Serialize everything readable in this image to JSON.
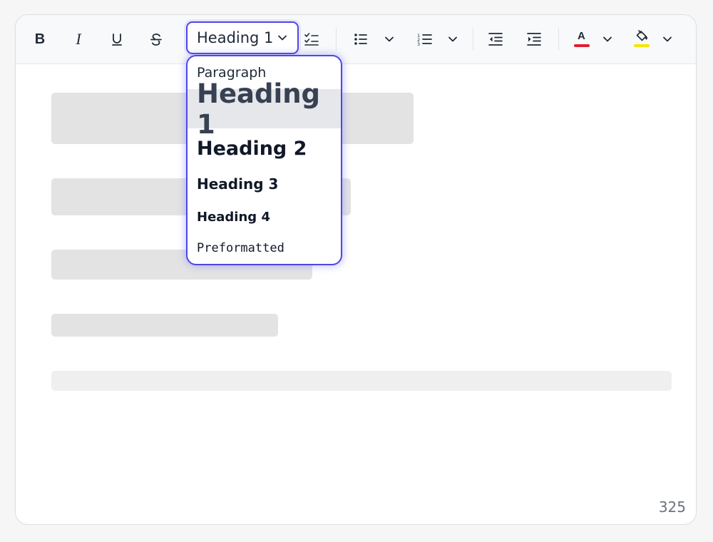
{
  "toolbar": {
    "buttons": {
      "bold": "bold-icon",
      "italic": "italic-icon",
      "underline": "underline-icon",
      "strikethrough": "strikethrough-icon",
      "checklist": "checklist-icon",
      "bullet_list": "bullet-list-icon",
      "numbered_list": "numbered-list-icon",
      "outdent": "outdent-icon",
      "indent": "indent-icon",
      "text_color": "text-color-icon",
      "highlight": "highlight-icon"
    },
    "bold_glyph": "B",
    "italic_glyph": "I",
    "text_color_glyph": "A",
    "block_select": {
      "value": "Heading 1"
    },
    "text_color": "#e11d2e",
    "highlight_color": "#f5e600"
  },
  "dropdown": {
    "items": [
      {
        "label": "Paragraph",
        "selected": false
      },
      {
        "label": "Heading 1",
        "selected": true
      },
      {
        "label": "Heading 2",
        "selected": false
      },
      {
        "label": "Heading 3",
        "selected": false
      },
      {
        "label": "Heading 4",
        "selected": false
      },
      {
        "label": "Preformatted",
        "selected": false
      }
    ]
  },
  "footer": {
    "character_count": "325"
  },
  "colors": {
    "accent": "#4f46e5",
    "placeholder": "#e3e3e4"
  }
}
